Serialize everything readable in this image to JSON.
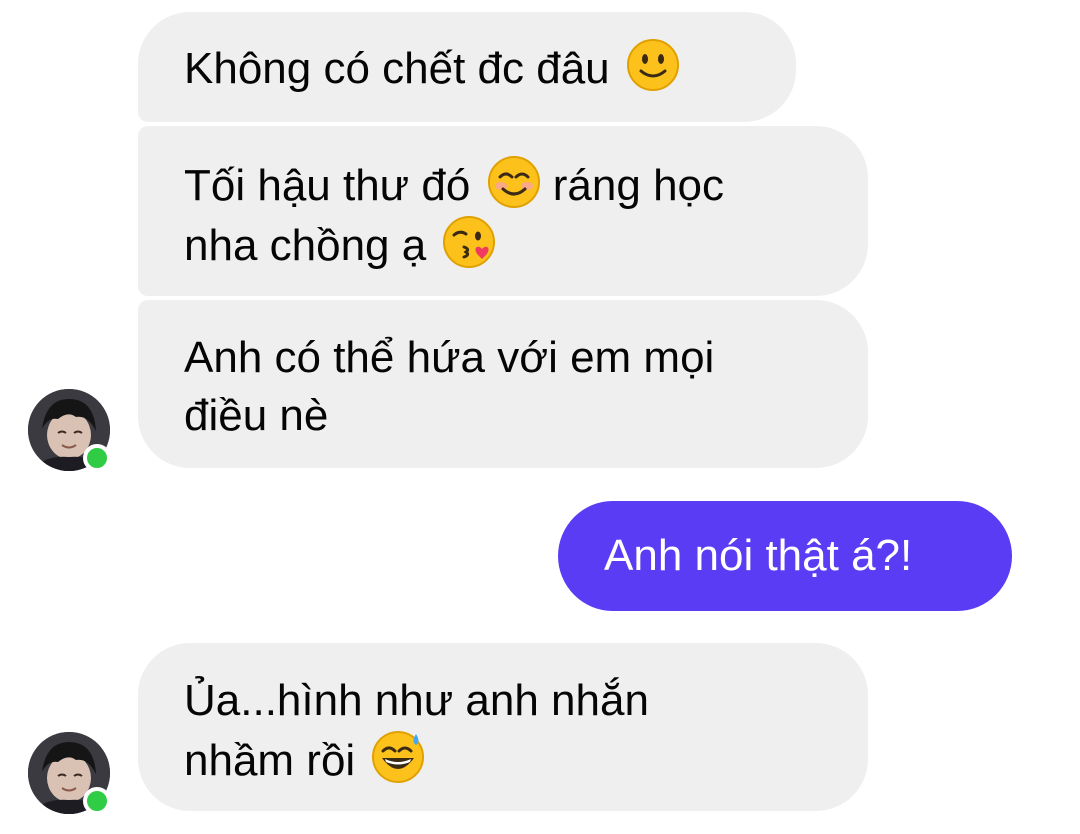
{
  "messages": [
    {
      "id": "b1",
      "direction": "incoming",
      "lines": [
        {
          "text": "Không có chết đc đâu",
          "emoji": "slightly-smiling-face"
        }
      ]
    },
    {
      "id": "b2",
      "direction": "incoming",
      "lines": [
        {
          "text": "Tối hậu thư đó",
          "emoji": "smiling-face",
          "after": "ráng học"
        },
        {
          "text": "nha chồng ạ",
          "emoji": "face-blowing-kiss"
        }
      ]
    },
    {
      "id": "b3",
      "direction": "incoming",
      "lines": [
        {
          "text": "Anh có thể hứa với em mọi"
        },
        {
          "text": "điều nè"
        }
      ]
    },
    {
      "id": "b-out",
      "direction": "outgoing",
      "text": "Anh nói thật á?!"
    },
    {
      "id": "b4",
      "direction": "incoming",
      "lines": [
        {
          "text": "Ủa...hình như anh nhắn"
        },
        {
          "text": "nhầm rồi",
          "emoji": "grinning-face-with-sweat"
        }
      ]
    }
  ],
  "contact": {
    "online": true,
    "online_color": "#31cc46"
  },
  "colors": {
    "incoming_bubble": "#efefef",
    "outgoing_bubble": "#5b3cf5",
    "incoming_text": "#050505",
    "outgoing_text": "#ffffff",
    "background": "#ffffff"
  }
}
